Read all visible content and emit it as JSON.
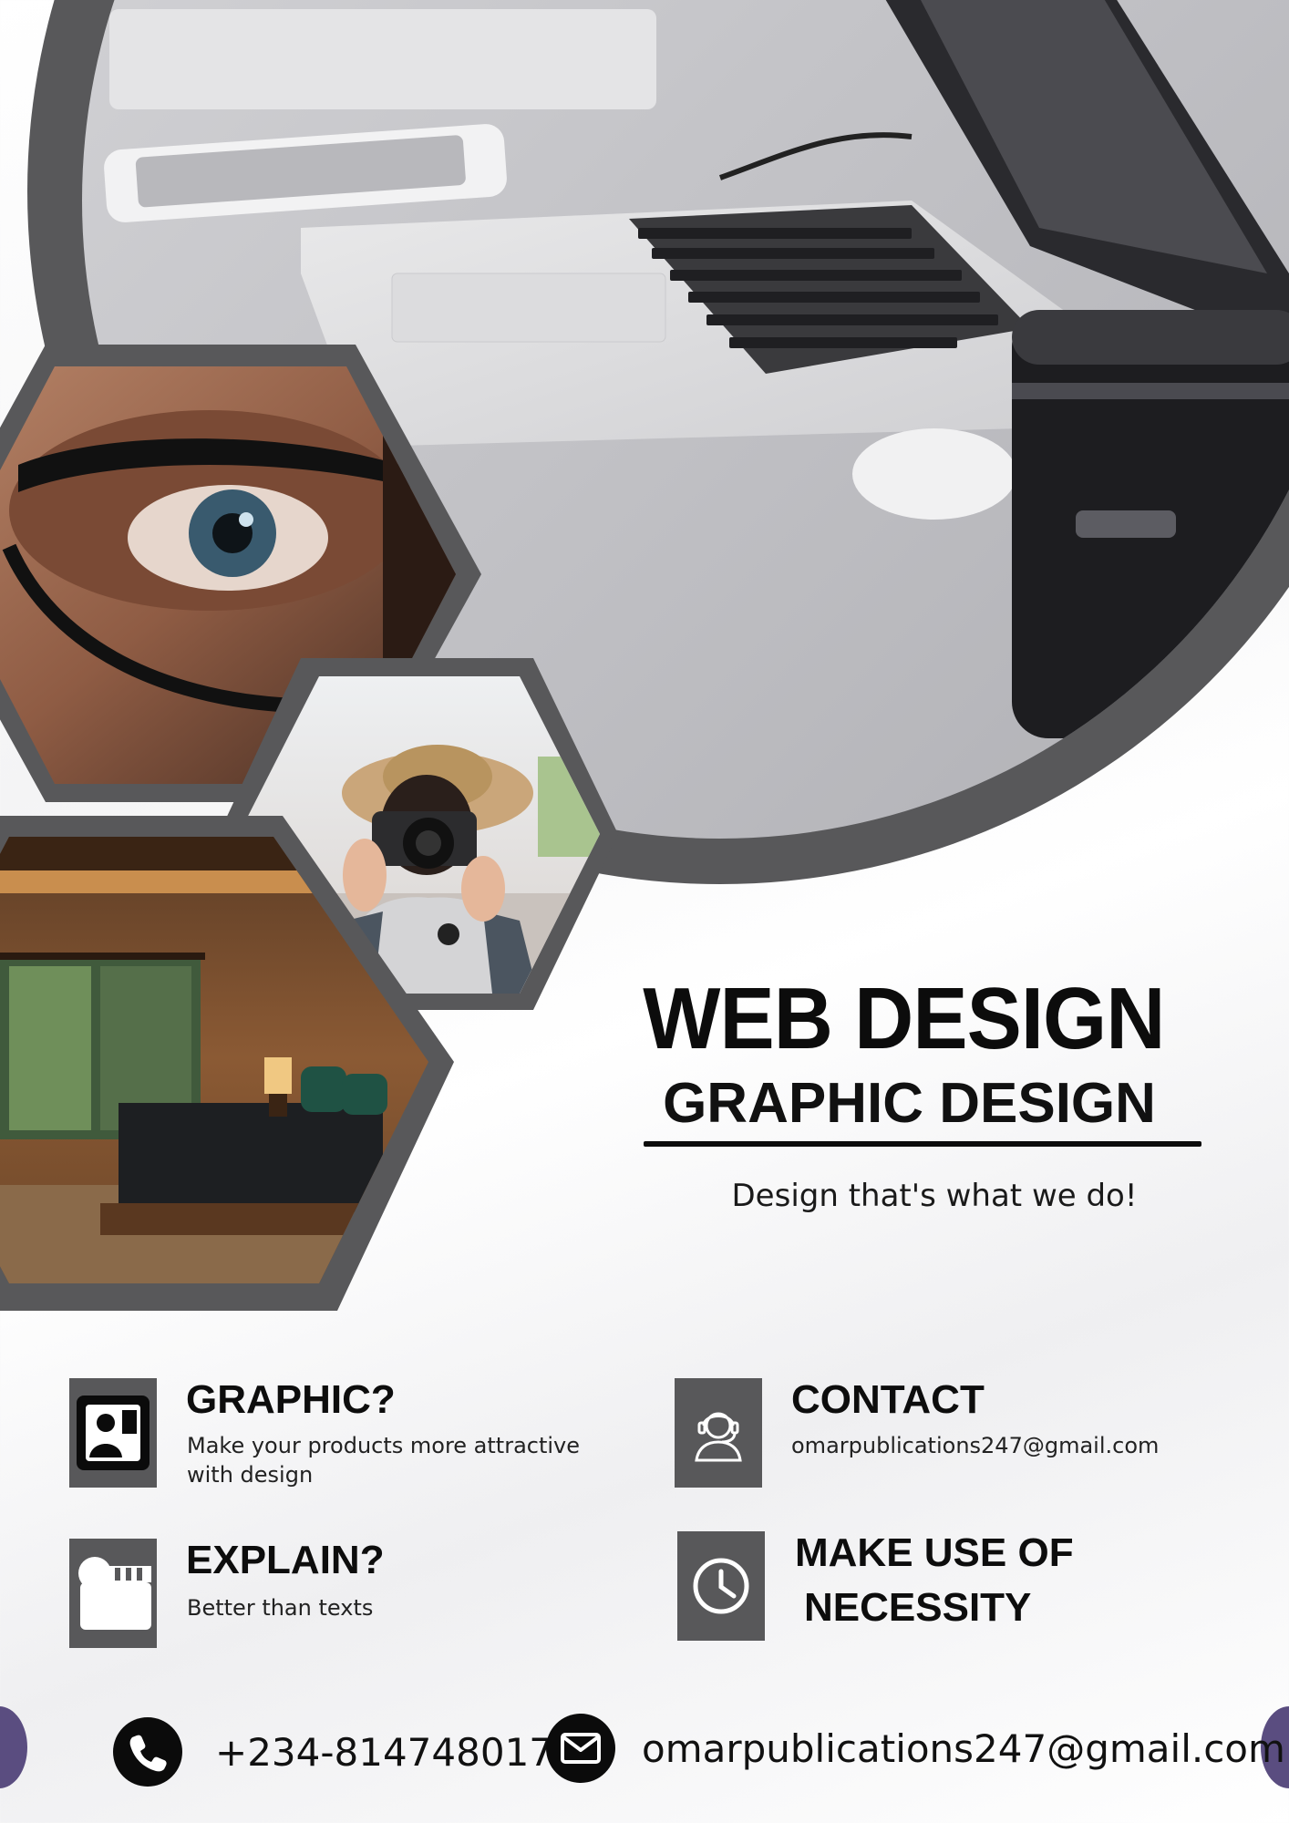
{
  "headline": {
    "main": "WEB DESIGN",
    "sub": "GRAPHIC DESIGN",
    "tagline": "Design that's what we do!"
  },
  "features": [
    {
      "title": "GRAPHIC?",
      "text": "Make your products more attractive with design",
      "icon": "portrait-icon"
    },
    {
      "title": "CONTACT",
      "text": "omarpublications247@gmail.com",
      "icon": "headset-support-icon"
    },
    {
      "title": "EXPLAIN?",
      "text": "Better than texts",
      "icon": "clapperboard-icon"
    },
    {
      "title_line1": "MAKE USE OF",
      "title_line2": "NECESSITY",
      "icon": "clock-icon"
    }
  ],
  "footer": {
    "phone": "+234-8147480172",
    "email": "omarpublications247@gmail.com",
    "phone_icon": "phone-icon",
    "email_icon": "mail-icon"
  },
  "colors": {
    "frame_gray": "#58585a",
    "text_dark": "#0c0c0c",
    "accent_purple": "#5a4d80"
  }
}
